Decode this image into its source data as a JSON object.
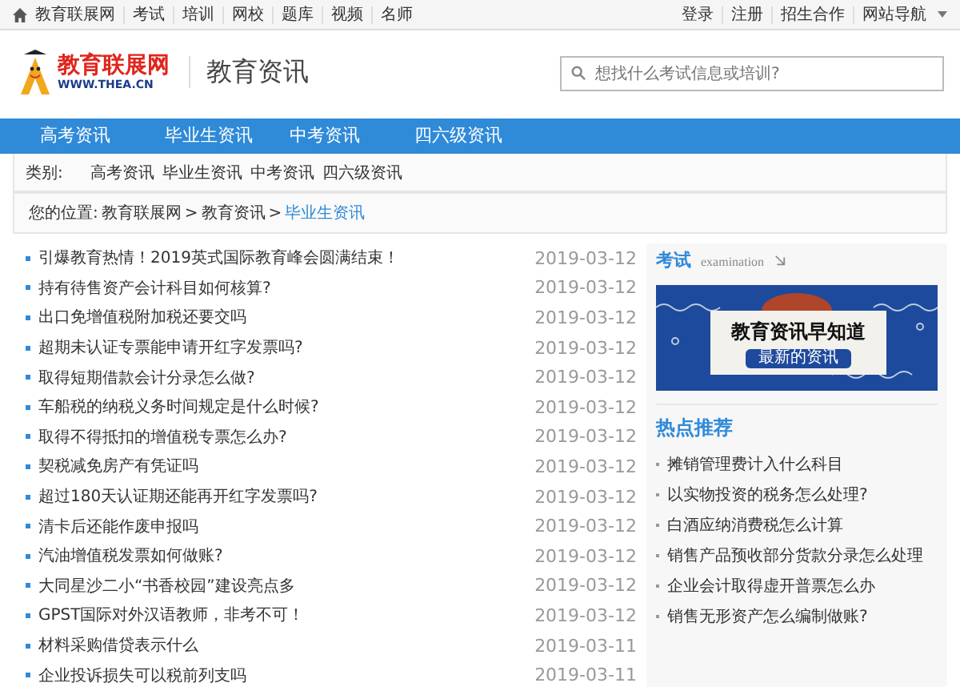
{
  "top_bar": {
    "left_links": [
      "教育联展网",
      "考试",
      "培训",
      "网校",
      "题库",
      "视频",
      "名师"
    ],
    "right_links": [
      "登录",
      "注册",
      "招生合作",
      "网站导航"
    ]
  },
  "header": {
    "logo_name": "教育联展网",
    "logo_url": "WWW.THEA.CN",
    "section_title": "教育资讯",
    "search": {
      "placeholder": "想找什么考试信息或培训?"
    }
  },
  "nav": [
    {
      "label": "高考资讯",
      "selected": false
    },
    {
      "label": "毕业生资讯",
      "selected": false
    },
    {
      "label": "中考资讯",
      "selected": false
    },
    {
      "label": "四六级资讯",
      "selected": false
    }
  ],
  "categories": {
    "label": "类别:",
    "items": [
      "高考资讯",
      "毕业生资讯",
      "中考资讯",
      "四六级资讯"
    ]
  },
  "breadcrumb": {
    "label": "您的位置:",
    "items": [
      "教育联展网",
      "教育资讯",
      "毕业生资讯"
    ],
    "separators": [
      ">",
      ">"
    ]
  },
  "articles": [
    {
      "title": "引爆教育热情！2019英式国际教育峰会圆满结束！",
      "date": "2019-03-12"
    },
    {
      "title": "持有待售资产会计科目如何核算?",
      "date": "2019-03-12"
    },
    {
      "title": "出口免增值税附加税还要交吗",
      "date": "2019-03-12"
    },
    {
      "title": "超期未认证专票能申请开红字发票吗?",
      "date": "2019-03-12"
    },
    {
      "title": "取得短期借款会计分录怎么做?",
      "date": "2019-03-12"
    },
    {
      "title": "车船税的纳税义务时间规定是什么时候?",
      "date": "2019-03-12"
    },
    {
      "title": "取得不得抵扣的增值税专票怎么办?",
      "date": "2019-03-12"
    },
    {
      "title": "契税减免房产有凭证吗",
      "date": "2019-03-12"
    },
    {
      "title": "超过180天认证期还能再开红字发票吗?",
      "date": "2019-03-12"
    },
    {
      "title": "清卡后还能作废申报吗",
      "date": "2019-03-12"
    },
    {
      "title": "汽油增值税发票如何做账?",
      "date": "2019-03-12"
    },
    {
      "title": "大同星沙二小“书香校园”建设亮点多",
      "date": "2019-03-12"
    },
    {
      "title": "GPST国际对外汉语教师，非考不可！",
      "date": "2019-03-12"
    },
    {
      "title": "材料采购借贷表示什么",
      "date": "2019-03-11"
    },
    {
      "title": "企业投诉损失可以税前列支吗",
      "date": "2019-03-11"
    }
  ],
  "sidebar": {
    "exam": {
      "title": "考试",
      "subtitle": "examination",
      "banner": {
        "headline": "教育资讯早知道",
        "button": "最新的资讯"
      }
    },
    "hot": {
      "title": "热点推荐",
      "items": [
        "摊销管理费计入什么科目",
        "以实物投资的税务怎么处理?",
        "白酒应纳消费税怎么计算",
        "销售产品预收部分货款分录怎么处理",
        "企业会计取得虚开普票怎么办",
        "销售无形资产怎么编制做账?"
      ]
    }
  }
}
